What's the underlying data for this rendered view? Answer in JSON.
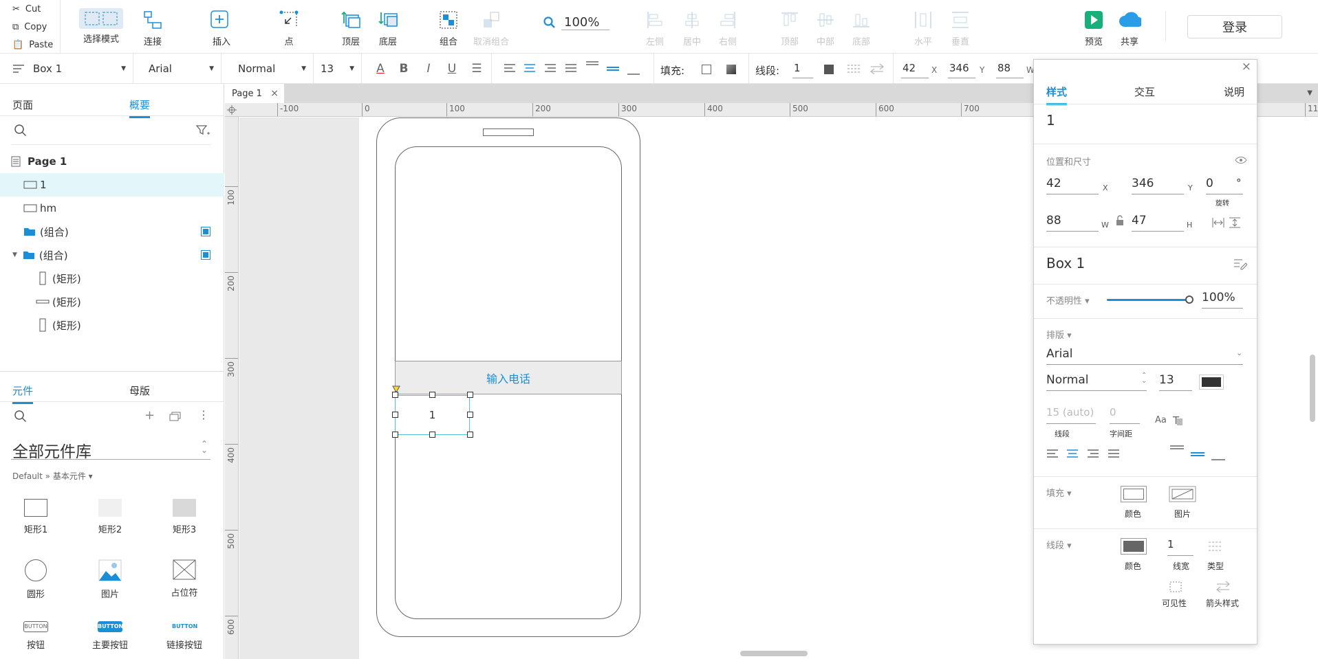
{
  "clipboard": {
    "cut": "Cut",
    "copy": "Copy",
    "paste": "Paste"
  },
  "toolbar": {
    "select_mode": "选择模式",
    "connect": "连接",
    "insert": "插入",
    "point": "点",
    "top_layer": "顶层",
    "bottom_layer": "底层",
    "group": "组合",
    "ungroup": "取消组合",
    "zoom": "100%",
    "align_left": "左侧",
    "align_center": "居中",
    "align_right": "右侧",
    "align_top": "顶部",
    "align_middle": "中部",
    "align_bottom": "底部",
    "distribute_h": "水平",
    "distribute_v": "垂直",
    "preview": "预览",
    "share": "共享",
    "login": "登录"
  },
  "formatbar": {
    "style": "Box 1",
    "font": "Arial",
    "weight": "Normal",
    "size": "13",
    "fill_label": "填充:",
    "stroke_label": "线段:",
    "stroke_width": "1",
    "x": "42",
    "x_unit": "X",
    "y": "346",
    "y_unit": "Y",
    "w": "88",
    "w_unit": "W"
  },
  "leftpanel": {
    "tabs": [
      "页面",
      "概要"
    ],
    "outline": [
      {
        "label": "Page 1"
      },
      {
        "label": "1"
      },
      {
        "label": "hm"
      },
      {
        "label": "(组合)"
      },
      {
        "label": "(组合)"
      },
      {
        "label": "(矩形)"
      },
      {
        "label": "(矩形)"
      },
      {
        "label": "(矩形)"
      }
    ],
    "lib_tabs": [
      "元件",
      "母版"
    ],
    "library_title": "全部元件库",
    "library_path": "Default » 基本元件 ▾",
    "widgets": [
      "矩形1",
      "矩形2",
      "矩形3",
      "圆形",
      "图片",
      "占位符",
      "按钮",
      "主要按钮",
      "链接按钮"
    ],
    "button_text": "BUTTON"
  },
  "canvas": {
    "page_tab": "Page 1",
    "ruler_h": [
      "-100",
      "0",
      "100",
      "200",
      "300",
      "400",
      "500",
      "600",
      "700",
      "11"
    ],
    "ruler_v": [
      "100",
      "200",
      "300",
      "400",
      "500",
      "600"
    ],
    "field_text": "输入电话",
    "box_text": "1"
  },
  "inspector": {
    "tabs": [
      "样式",
      "交互",
      "说明"
    ],
    "name": "1",
    "pos_size_label": "位置和尺寸",
    "x": "42",
    "x_unit": "X",
    "y": "346",
    "y_unit": "Y",
    "rotation": "0",
    "rotation_unit": "°",
    "rotation_label": "旋转",
    "w": "88",
    "w_unit": "W",
    "h": "47",
    "h_unit": "H",
    "style_name": "Box 1",
    "opacity_label": "不透明性 ▾",
    "opacity": "100%",
    "opacity_value": 1.0,
    "typography_label": "排版 ▾",
    "font": "Arial",
    "weight": "Normal",
    "size": "13",
    "text_color": "#333333",
    "line_height": "15 (auto)",
    "line_height_label": "线段",
    "char_spacing": "0",
    "char_spacing_label": "字间距",
    "fill_label": "填充 ▾",
    "fill_color_label": "颜色",
    "fill_image_label": "图片",
    "stroke_label": "线段 ▾",
    "stroke_color_label": "颜色",
    "stroke_width": "1",
    "stroke_width_label": "线宽",
    "stroke_type_label": "类型",
    "visibility_label": "可见性",
    "arrow_label": "箭头样式"
  },
  "colors": {
    "accent": "#1a8fd8",
    "preview_green": "#18b07a",
    "share_blue": "#2b9de8",
    "selection": "#4fc3d1"
  }
}
